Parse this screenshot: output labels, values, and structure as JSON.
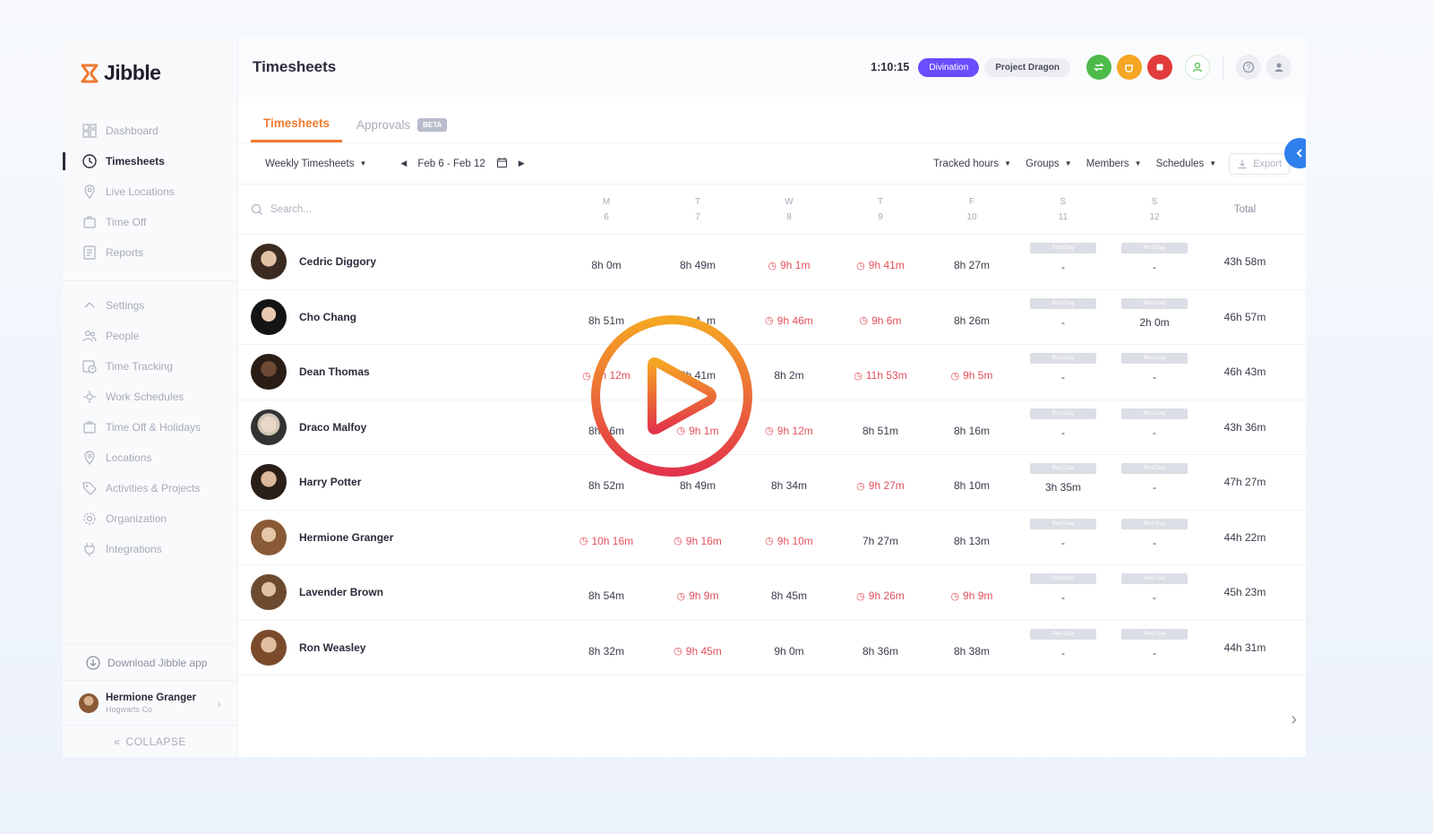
{
  "brand": {
    "name": "Jibble",
    "logo_color": "#f07a2e"
  },
  "sidebar": {
    "items": [
      {
        "label": "Dashboard",
        "icon": "dashboard-icon",
        "active": false
      },
      {
        "label": "Timesheets",
        "icon": "clock-icon",
        "active": true
      },
      {
        "label": "Live Locations",
        "icon": "location-pin-icon",
        "active": false
      },
      {
        "label": "Time Off",
        "icon": "suitcase-icon",
        "active": false
      },
      {
        "label": "Reports",
        "icon": "report-icon",
        "active": false
      }
    ],
    "settings_items": [
      {
        "label": "Settings",
        "icon": "chevron-up-icon"
      },
      {
        "label": "People",
        "icon": "people-icon"
      },
      {
        "label": "Time Tracking",
        "icon": "time-tracking-icon"
      },
      {
        "label": "Work Schedules",
        "icon": "schedule-icon"
      },
      {
        "label": "Time Off & Holidays",
        "icon": "suitcase-icon"
      },
      {
        "label": "Locations",
        "icon": "location-pin-icon"
      },
      {
        "label": "Activities & Projects",
        "icon": "tag-icon"
      },
      {
        "label": "Organization",
        "icon": "gear-icon"
      },
      {
        "label": "Integrations",
        "icon": "plug-icon"
      }
    ],
    "download_label": "Download Jibble app",
    "user": {
      "name": "Hermione Granger",
      "org": "Hogwarts Co"
    },
    "collapse_label": "COLLAPSE"
  },
  "header": {
    "title": "Timesheets",
    "timer": "1:10:15",
    "activity": "Divination",
    "project": "Project Dragon",
    "accent": "#6b4dff"
  },
  "tabs": [
    {
      "label": "Timesheets",
      "active": true
    },
    {
      "label": "Approvals",
      "badge": "BETA",
      "active": false
    }
  ],
  "toolbar": {
    "view": "Weekly Timesheets",
    "date_range": "Feb 6 - Feb 12",
    "filters": [
      "Tracked hours",
      "Groups",
      "Members",
      "Schedules"
    ],
    "export_label": "Export"
  },
  "table": {
    "search_placeholder": "Search...",
    "days": [
      {
        "letter": "M",
        "num": "6"
      },
      {
        "letter": "T",
        "num": "7"
      },
      {
        "letter": "W",
        "num": "8"
      },
      {
        "letter": "T",
        "num": "9"
      },
      {
        "letter": "F",
        "num": "10"
      },
      {
        "letter": "S",
        "num": "11"
      },
      {
        "letter": "S",
        "num": "12"
      }
    ],
    "total_label": "Total",
    "rest_label": "Rest Day",
    "rows": [
      {
        "name": "Cedric Diggory",
        "cells": [
          {
            "v": "8h 0m"
          },
          {
            "v": "8h 49m"
          },
          {
            "v": "9h 1m",
            "over": true
          },
          {
            "v": "9h 41m",
            "over": true
          },
          {
            "v": "8h 27m"
          },
          {
            "v": "-",
            "rest": true
          },
          {
            "v": "-",
            "rest": true
          }
        ],
        "total": "43h 58m"
      },
      {
        "name": "Cho Chang",
        "cells": [
          {
            "v": "8h 51m"
          },
          {
            "v": "8h 4_m"
          },
          {
            "v": "9h 46m",
            "over": true
          },
          {
            "v": "9h 6m",
            "over": true
          },
          {
            "v": "8h 26m"
          },
          {
            "v": "-",
            "rest": true
          },
          {
            "v": "2h 0m",
            "rest": true
          }
        ],
        "total": "46h 57m"
      },
      {
        "name": "Dean Thomas",
        "cells": [
          {
            "v": "9h 12m",
            "over": true
          },
          {
            "v": "8h 41m"
          },
          {
            "v": "8h 2m"
          },
          {
            "v": "11h 53m",
            "over": true
          },
          {
            "v": "9h 5m",
            "over": true
          },
          {
            "v": "-",
            "rest": true
          },
          {
            "v": "-",
            "rest": true
          }
        ],
        "total": "46h 43m"
      },
      {
        "name": "Draco Malfoy",
        "cells": [
          {
            "v": "8h 16m"
          },
          {
            "v": "9h 1m",
            "over": true
          },
          {
            "v": "9h 12m",
            "over": true
          },
          {
            "v": "8h 51m"
          },
          {
            "v": "8h 16m"
          },
          {
            "v": "-",
            "rest": true
          },
          {
            "v": "-",
            "rest": true
          }
        ],
        "total": "43h 36m"
      },
      {
        "name": "Harry Potter",
        "cells": [
          {
            "v": "8h 52m"
          },
          {
            "v": "8h 49m"
          },
          {
            "v": "8h 34m"
          },
          {
            "v": "9h 27m",
            "over": true
          },
          {
            "v": "8h 10m"
          },
          {
            "v": "3h 35m",
            "rest": true
          },
          {
            "v": "-",
            "rest": true
          }
        ],
        "total": "47h 27m"
      },
      {
        "name": "Hermione Granger",
        "cells": [
          {
            "v": "10h 16m",
            "over": true
          },
          {
            "v": "9h 16m",
            "over": true
          },
          {
            "v": "9h 10m",
            "over": true
          },
          {
            "v": "7h 27m"
          },
          {
            "v": "8h 13m"
          },
          {
            "v": "-",
            "rest": true
          },
          {
            "v": "-",
            "rest": true
          }
        ],
        "total": "44h 22m"
      },
      {
        "name": "Lavender Brown",
        "cells": [
          {
            "v": "8h 54m"
          },
          {
            "v": "9h 9m",
            "over": true
          },
          {
            "v": "8h 45m"
          },
          {
            "v": "9h 26m",
            "over": true
          },
          {
            "v": "9h 9m",
            "over": true
          },
          {
            "v": "-",
            "rest": true
          },
          {
            "v": "-",
            "rest": true
          }
        ],
        "total": "45h 23m"
      },
      {
        "name": "Ron Weasley",
        "cells": [
          {
            "v": "8h 32m"
          },
          {
            "v": "9h 45m",
            "over": true
          },
          {
            "v": "9h 0m"
          },
          {
            "v": "8h 36m"
          },
          {
            "v": "8h 38m"
          },
          {
            "v": "-",
            "rest": true
          },
          {
            "v": "-",
            "rest": true
          }
        ],
        "total": "44h 31m"
      }
    ]
  },
  "play_button": {
    "gradient_start": "#f5a623",
    "gradient_end": "#e2344b"
  }
}
